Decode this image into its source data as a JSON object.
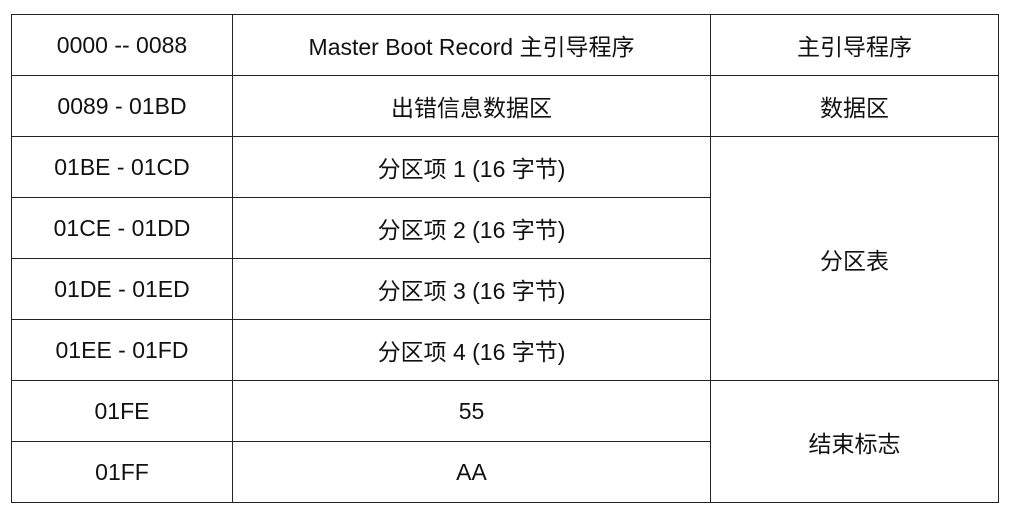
{
  "rows": [
    {
      "range": "0000 -- 0088",
      "content": "Master Boot Record 主引导程序",
      "group": "主引导程序"
    },
    {
      "range": "0089 - 01BD",
      "content": "出错信息数据区",
      "group": "数据区"
    },
    {
      "range": "01BE - 01CD",
      "content": "分区项 1 (16 字节)",
      "group": "分区表"
    },
    {
      "range": "01CE - 01DD",
      "content": "分区项 2 (16 字节)"
    },
    {
      "range": "01DE - 01ED",
      "content": "分区项 3 (16 字节)"
    },
    {
      "range": "01EE - 01FD",
      "content": "分区项 4 (16 字节)"
    },
    {
      "range": "01FE",
      "content": "55",
      "group": "结束标志"
    },
    {
      "range": "01FF",
      "content": "AA"
    }
  ]
}
